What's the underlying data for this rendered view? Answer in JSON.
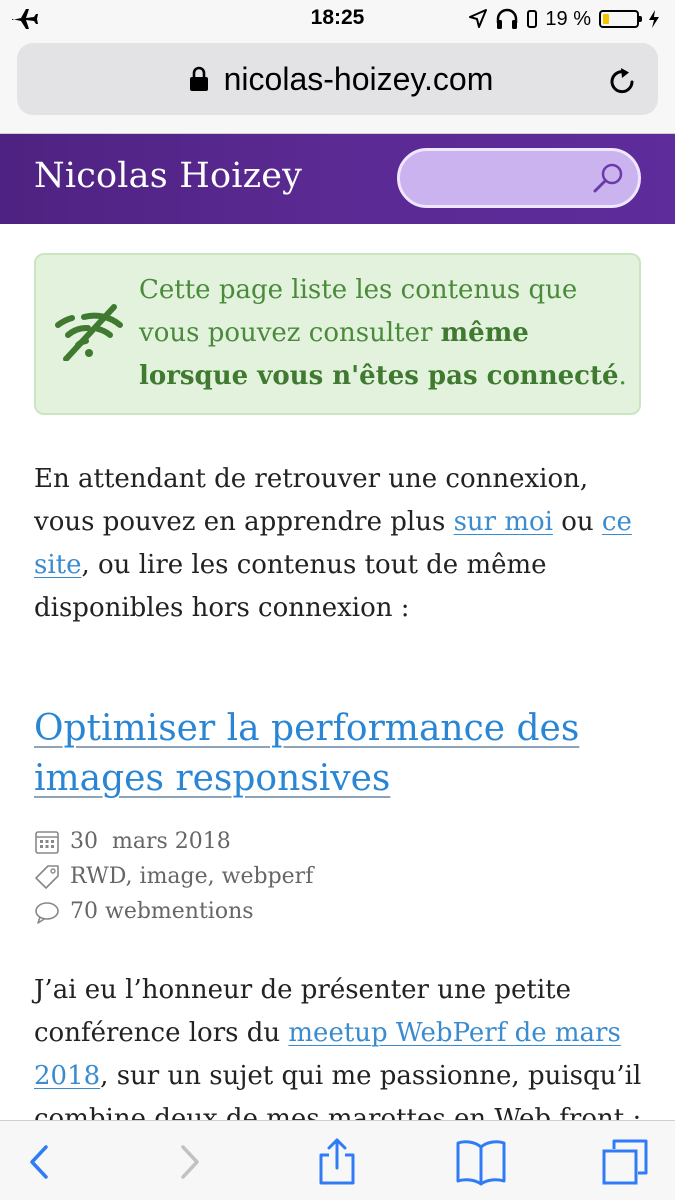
{
  "status_bar": {
    "time": "18:25",
    "battery_text": "19 %",
    "battery_level": 0.19
  },
  "browser": {
    "url": "nicolas-hoizey.com"
  },
  "site": {
    "title": "Nicolas Hoizey",
    "search_placeholder": ""
  },
  "notice": {
    "text_before": "Cette page liste les contenus que vous pouvez consulter ",
    "text_bold": "même lorsque vous n'êtes pas connecté",
    "text_after": "."
  },
  "intro": {
    "part1": "En attendant de retrouver une connexion, vous pouvez en apprendre plus ",
    "link1": "sur moi",
    "part2": " ou ",
    "link2": "ce site",
    "part3": ", ou lire les contenus tout de même disponibles hors connexion :"
  },
  "article": {
    "title": "Optimiser la performance des images responsives",
    "date": "30  mars 2018",
    "tags": "RWD, image, webperf",
    "webmentions": "70 webmentions",
    "text_part1": "J’ai eu l’honneur de présenter une petite conférence lors du ",
    "link": "meetup WebPerf de mars 2018",
    "text_part2": ", sur un sujet qui me passionne, puisqu’il combine deux de mes marottes en Web front :"
  },
  "colors": {
    "header_purple": "#5b2a93",
    "link_blue": "#3a8ccf",
    "notice_green": "#4a8a3a",
    "ios_blue": "#2f7cf6"
  }
}
